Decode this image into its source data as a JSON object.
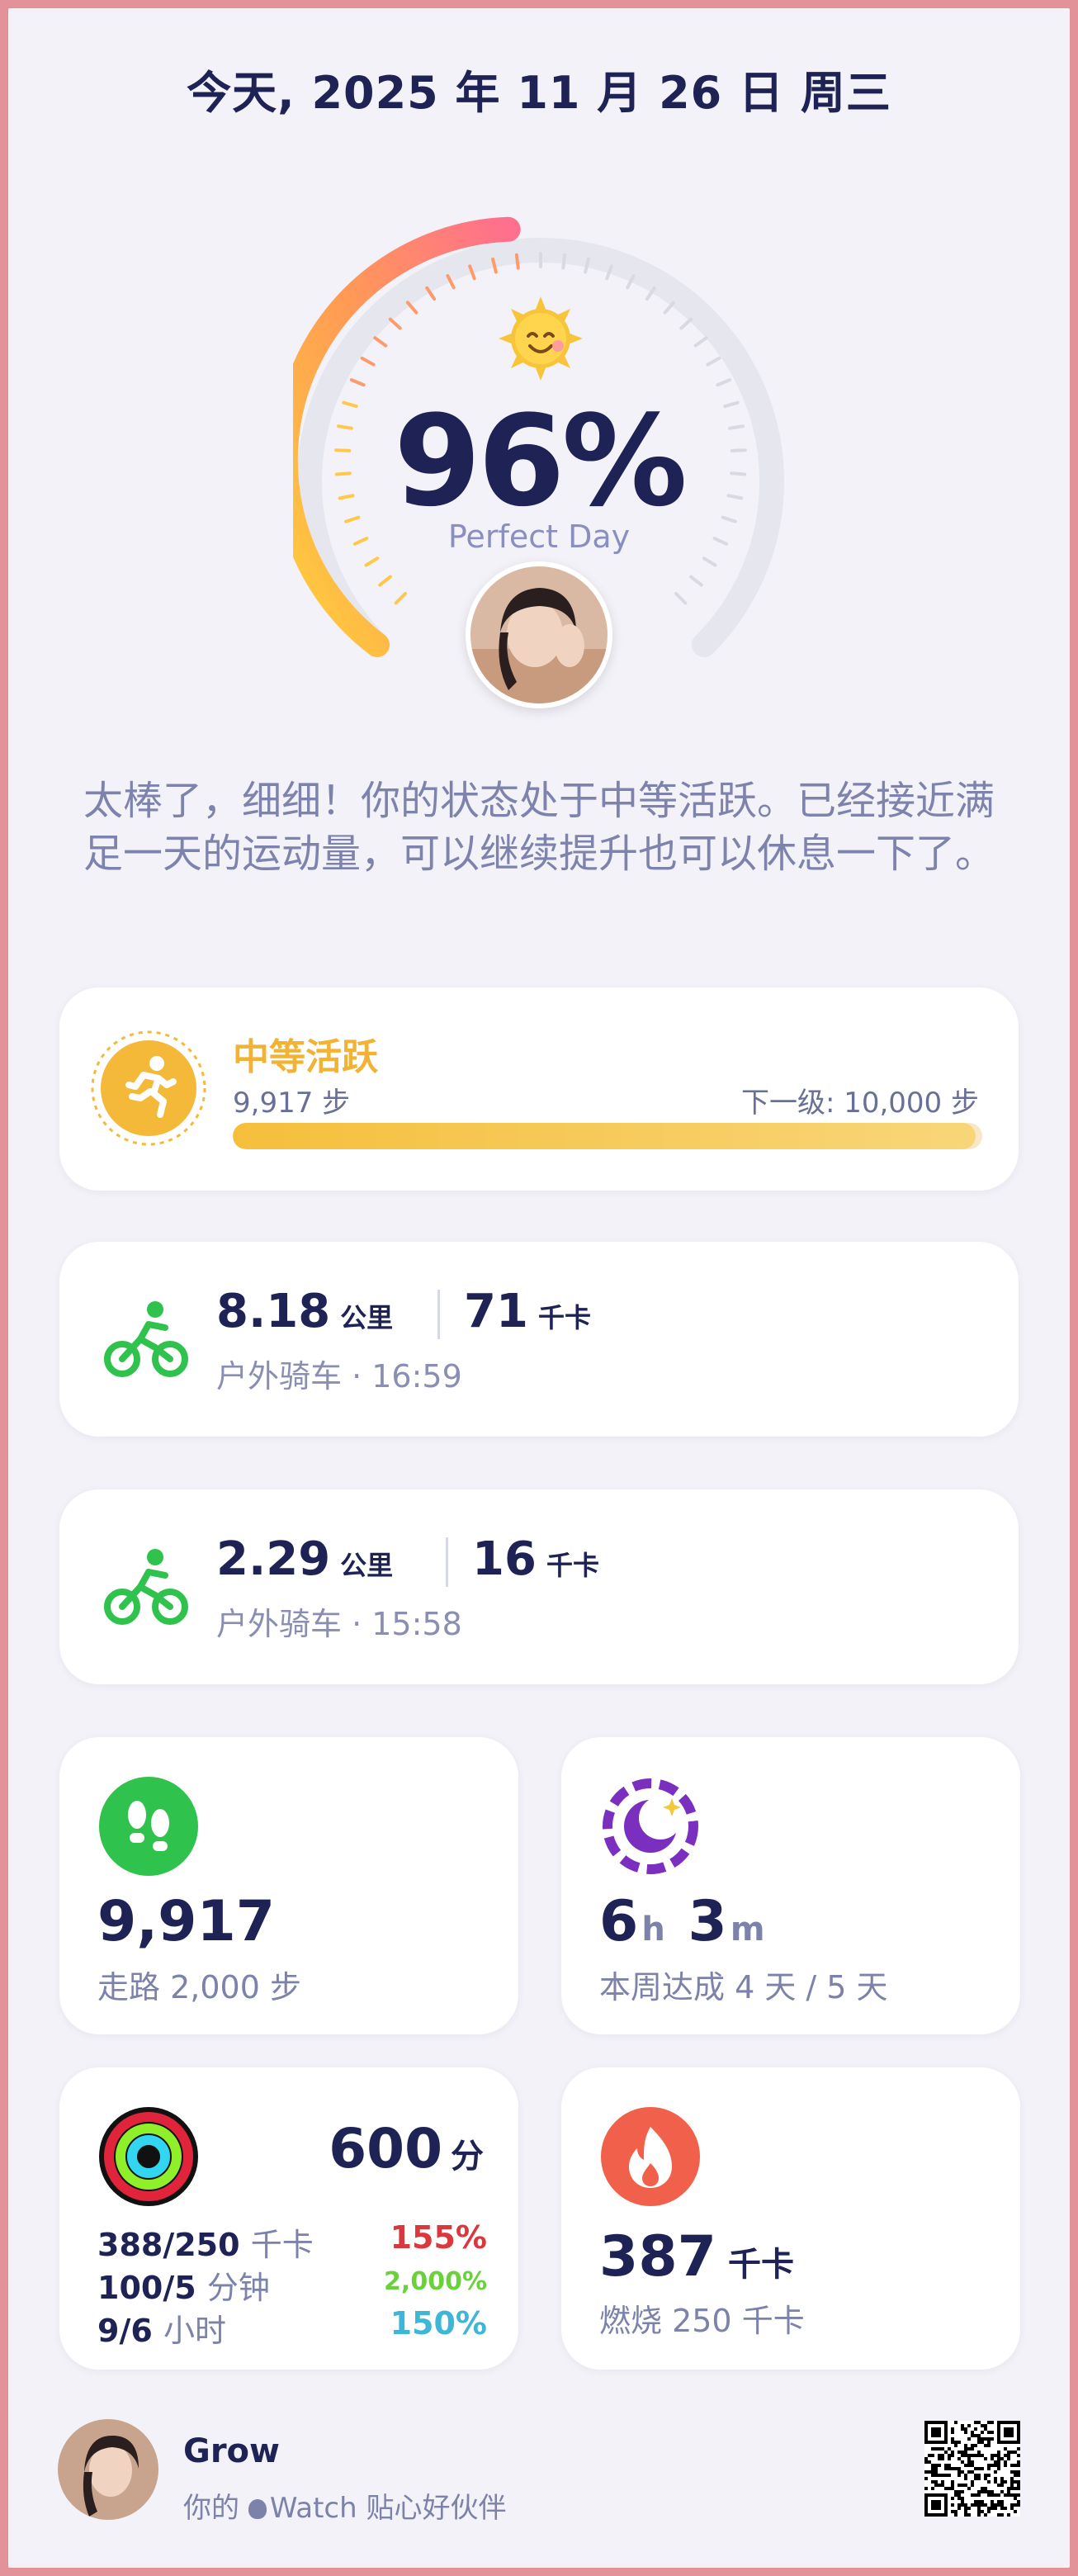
{
  "header": {
    "date": "今天, 2025 年 11 月 26 日 周三"
  },
  "score": {
    "percent": "96%",
    "value": 96,
    "label": "Perfect Day"
  },
  "message": "太棒了，细细！你的状态处于中等活跃。已经接近满足一天的运动量，可以继续提升也可以休息一下了。",
  "activity_level": {
    "title": "中等活跃",
    "steps": "9,917 步",
    "next": "下一级: 10,000 步",
    "progress": 0.9917
  },
  "rides": [
    {
      "distance": "8.18",
      "distance_unit": "公里",
      "calories": "71",
      "calories_unit": "千卡",
      "subtitle": "户外骑车 · 16:59"
    },
    {
      "distance": "2.29",
      "distance_unit": "公里",
      "calories": "16",
      "calories_unit": "千卡",
      "subtitle": "户外骑车 · 15:58"
    }
  ],
  "steps_tile": {
    "value": "9,917",
    "subtitle": "走路 2,000 步"
  },
  "sleep_tile": {
    "hours": "6",
    "h_unit": "h",
    "minutes": "3",
    "m_unit": "m",
    "subtitle": "本周达成  4 天 / 5 天"
  },
  "rings_tile": {
    "total": "600",
    "total_unit": "分",
    "rows": [
      {
        "value": "388/250",
        "unit": "千卡",
        "percent": "155%",
        "color": "#d9383d"
      },
      {
        "value": "100/5",
        "unit": "分钟",
        "percent": "2,000%",
        "color": "#6bd13b"
      },
      {
        "value": "9/6",
        "unit": "小时",
        "percent": "150%",
        "color": "#3fb6d6"
      }
    ]
  },
  "burn_tile": {
    "value": "387",
    "unit": "千卡",
    "subtitle": "燃烧 250 千卡"
  },
  "footer": {
    "name": "Grow",
    "tagline_pre": "你的 ",
    "tagline_post": "Watch 贴心好伙伴"
  },
  "colors": {
    "accent_yellow": "#f2b233",
    "bike_green": "#2fc24c",
    "moon_purple": "#7b2fbe",
    "fire_red": "#f0604a"
  }
}
